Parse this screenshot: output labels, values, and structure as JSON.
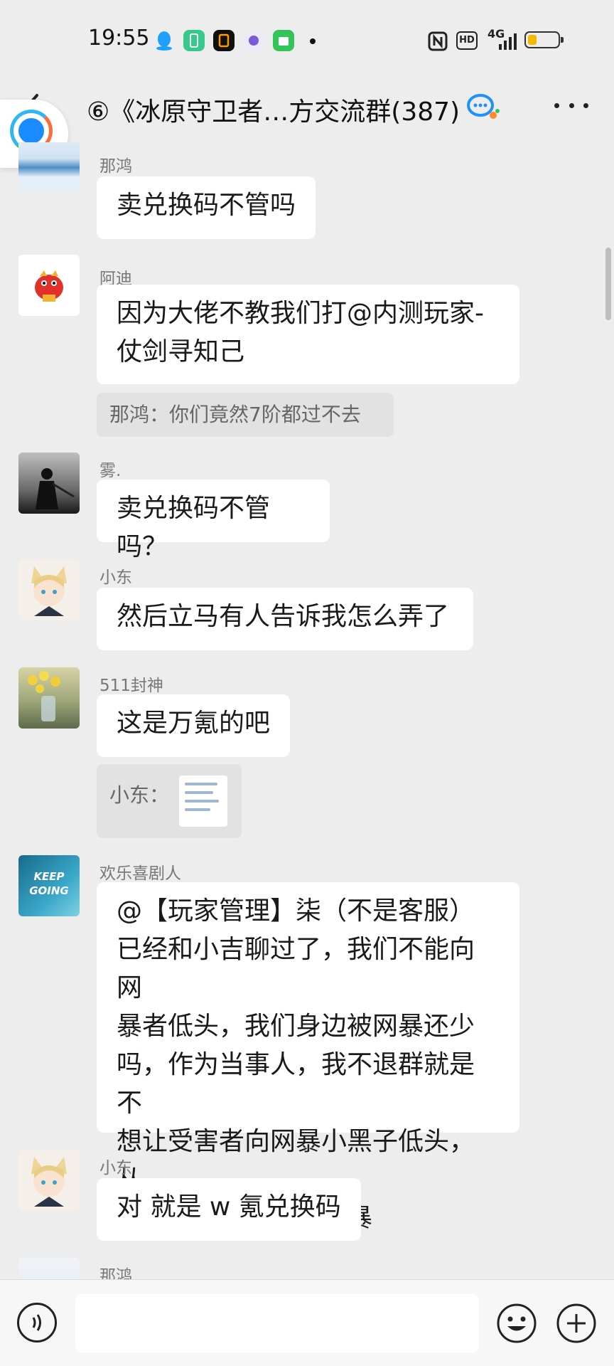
{
  "status_bar": {
    "time": "19:55",
    "network_label": "4G",
    "hd_label": "HD",
    "icons": [
      "qq-icon",
      "phone-manager-icon",
      "notes-icon",
      "message-icon",
      "store-icon",
      "nfc-icon",
      "signal-icon",
      "battery-icon"
    ],
    "battery_level": 0.25
  },
  "header": {
    "title": "⑥《冰原守卫者…方交流群(387)",
    "back_icon": "back-arrow-icon",
    "more_icon": "more-dots-icon"
  },
  "messages": [
    {
      "sender": "那鸿",
      "text": "卖兑换码不管吗",
      "avatar": "blue-ocean-avatar"
    },
    {
      "sender": "阿迪",
      "lines": [
        "因为大佬不教我们打@内测玩家-",
        "仗剑寻知己"
      ],
      "quote": "那鸿：你们竟然7阶都过不去",
      "avatar": "red-dragon-avatar"
    },
    {
      "sender": "雾.",
      "text": "卖兑换码不管吗？",
      "avatar": "warrior-avatar"
    },
    {
      "sender": "小东",
      "text": "然后立马有人告诉我怎么弄了",
      "avatar": "anime-boy-avatar"
    },
    {
      "sender": "511封神",
      "text": "这是万氪的吧",
      "quote_label": "小东：",
      "avatar": "flowers-avatar"
    },
    {
      "sender": "欢乐喜剧人",
      "lines": [
        "@【玩家管理】柒（不是客服）",
        "已经和小吉聊过了，我们不能向网",
        "暴者低头，我们身边被网暴还少",
        "吗，作为当事人，我不退群就是不",
        "想让受害者向网暴小黑子低头，从",
        "我做起，抵制恶意网暴"
      ],
      "avatar_text": "KEEP GOING",
      "avatar": "keep-going-avatar"
    },
    {
      "sender": "小东",
      "text": "对 就是 w 氪兑换码",
      "avatar": "anime-boy-avatar"
    },
    {
      "sender": "那鸿",
      "avatar": "blue-ocean-avatar"
    }
  ],
  "input_bar": {
    "placeholder": "",
    "icons": [
      "voice-icon",
      "emoji-icon",
      "plus-icon"
    ]
  },
  "colors": {
    "background": "#ededed",
    "bubble": "#ffffff",
    "quote_bg": "#e2e2e2",
    "sender_text": "#777777"
  }
}
